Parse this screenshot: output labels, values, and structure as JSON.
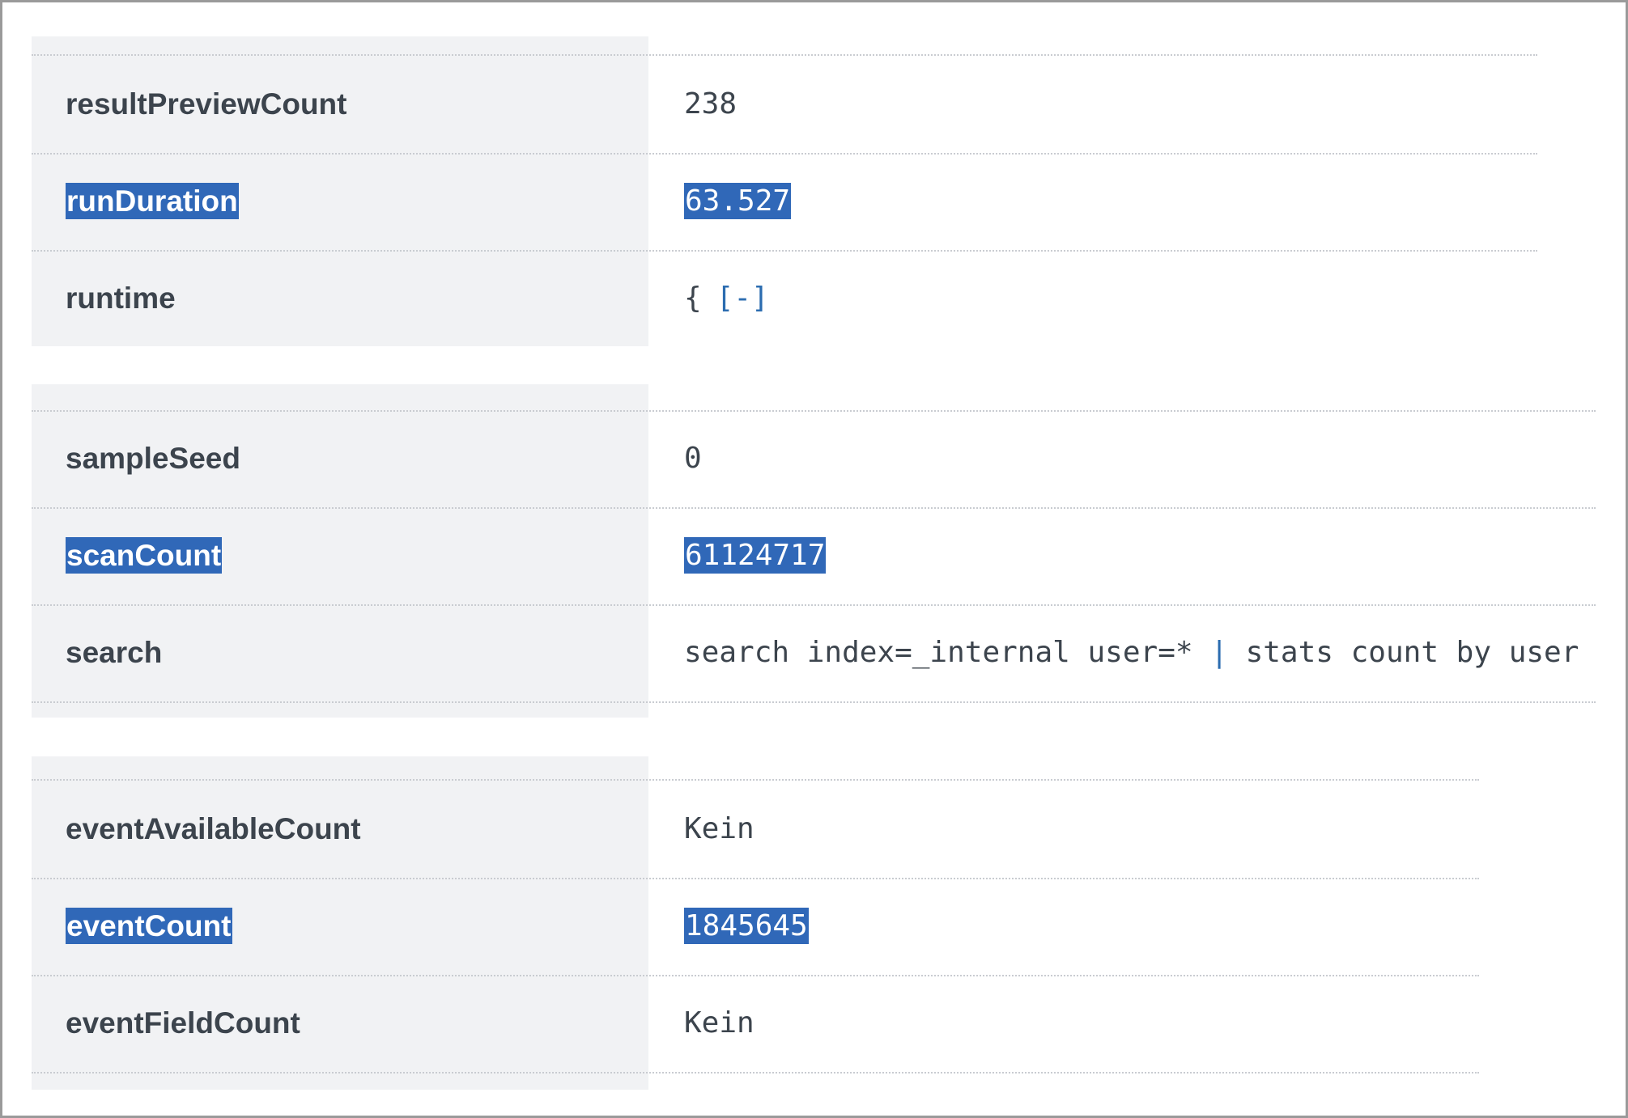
{
  "groups": [
    {
      "rows": [
        {
          "key": "resultPreviewCount",
          "value": "238",
          "highlighted": false
        },
        {
          "key": "runDuration",
          "value": "63.527",
          "highlighted": true
        },
        {
          "key": "runtime",
          "value_open": "{",
          "value_toggle": "[-]",
          "highlighted": false
        }
      ]
    },
    {
      "rows": [
        {
          "key": "sampleSeed",
          "value": "0",
          "highlighted": false
        },
        {
          "key": "scanCount",
          "value": "61124717",
          "highlighted": true
        },
        {
          "key": "search",
          "value_before": "search index=_internal user=* ",
          "value_pipe": "|",
          "value_after": " stats count by user",
          "highlighted": false
        }
      ]
    },
    {
      "rows": [
        {
          "key": "eventAvailableCount",
          "value": "Kein",
          "highlighted": false
        },
        {
          "key": "eventCount",
          "value": "1845645",
          "highlighted": true
        },
        {
          "key": "eventFieldCount",
          "value": "Kein",
          "highlighted": false
        }
      ]
    }
  ],
  "colors": {
    "highlight": "#3068b8",
    "key_column_bg": "#f1f2f4",
    "text": "#3c444d",
    "link": "#2b6cb0"
  }
}
